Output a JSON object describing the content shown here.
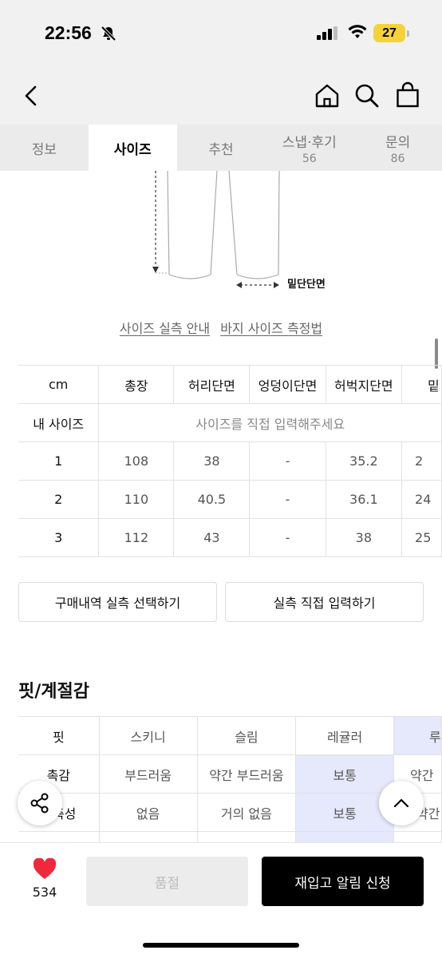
{
  "status_bar": {
    "time": "22:56",
    "battery": "27"
  },
  "tabs": [
    {
      "label": "정보",
      "count": ""
    },
    {
      "label": "사이즈",
      "count": ""
    },
    {
      "label": "추천",
      "count": ""
    },
    {
      "label": "스냅·후기",
      "count": "56"
    },
    {
      "label": "문의",
      "count": "86"
    }
  ],
  "illustration": {
    "hem_label": "밑단단면"
  },
  "links": {
    "size_guide": "사이즈 실측 안내",
    "pants_method": "바지 사이즈 측정법"
  },
  "size_table": {
    "headers": [
      "cm",
      "총장",
      "허리단면",
      "엉덩이단면",
      "허벅지단면",
      "밑"
    ],
    "my_size_label": "내 사이즈",
    "my_size_hint": "사이즈를 직접 입력해주세요",
    "rows": [
      [
        "1",
        "108",
        "38",
        "-",
        "35.2",
        "2"
      ],
      [
        "2",
        "110",
        "40.5",
        "-",
        "36.1",
        "24"
      ],
      [
        "3",
        "112",
        "43",
        "-",
        "38",
        "25"
      ]
    ]
  },
  "buttons": {
    "purchase_history": "구매내역 실측 선택하기",
    "direct_input": "실측 직접 입력하기"
  },
  "fit_section": {
    "title": "핏/계절감",
    "rows": [
      {
        "label": "핏",
        "options": [
          "스키니",
          "슬림",
          "레귤러",
          "루"
        ],
        "selected": 3
      },
      {
        "label": "촉감",
        "options": [
          "부드러움",
          "약간 부드러움",
          "보통",
          "약간"
        ],
        "selected": 2
      },
      {
        "label": "신축성",
        "options": [
          "없음",
          "거의 없음",
          "보통",
          "약간"
        ],
        "selected": 2
      }
    ]
  },
  "bottom_bar": {
    "likes": "534",
    "sold_out": "품절",
    "restock": "재입고 알림 신청"
  },
  "colors": {
    "accent_selected": "#e6e8fb",
    "heart": "#f0283c",
    "primary_button": "#000000"
  }
}
